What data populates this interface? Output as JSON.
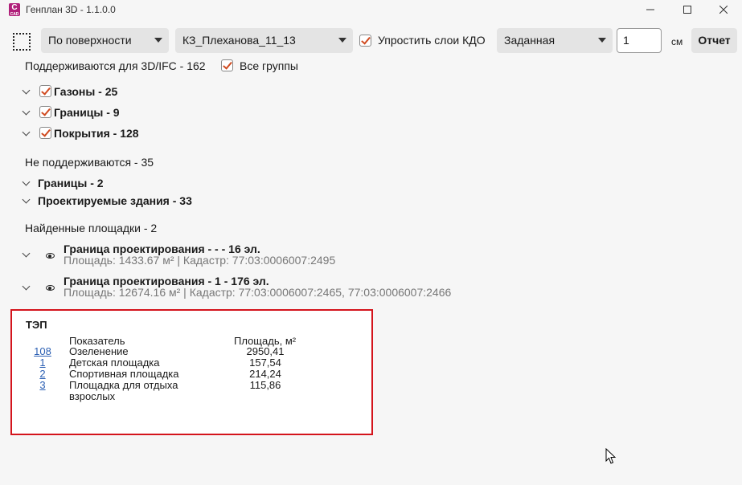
{
  "window": {
    "title": "Генплан 3D - 1.1.0.0",
    "icon_text": "C",
    "icon_sub": "CAD"
  },
  "toolbar": {
    "mode_dropdown": "По поверхности",
    "object_dropdown": "КЗ_Плеханова_11_13",
    "simplify_label": "Упростить слои КДО",
    "height_dropdown": "Заданная",
    "value_input": "1",
    "unit_label": "см",
    "report_button": "Отчет"
  },
  "supported": {
    "label": "Поддерживаются для 3D/IFC -  162",
    "all_groups_label": "Все группы",
    "groups": [
      {
        "label": "Газоны  -  25"
      },
      {
        "label": "Границы  -  9"
      },
      {
        "label": "Покрытия  -  128"
      }
    ]
  },
  "unsupported": {
    "label": "Не поддерживаются -  35",
    "groups": [
      {
        "label": "Границы  -  2"
      },
      {
        "label": "Проектируемые здания  -  33"
      }
    ]
  },
  "sites": {
    "label": "Найденные площадки -  2",
    "items": [
      {
        "title": "Граница проектирования  -  -  -  16  эл.",
        "details": "Площадь:  1433.67  м²   |  Кадастр:  77:03:0006007:2495"
      },
      {
        "title": "Граница проектирования  -  1  -  176  эл.",
        "details": "Площадь:  12674.16  м²   |  Кадастр:  77:03:0006007:2465, 77:03:0006007:2466"
      }
    ]
  },
  "tep": {
    "title": "ТЭП",
    "col_indicator": "Показатель",
    "col_area": "Площадь, м²",
    "rows": [
      {
        "count": "108",
        "name": "Озеленение",
        "area": "2950,41"
      },
      {
        "count": "1",
        "name": "Детская площадка",
        "area": "157,54"
      },
      {
        "count": "2",
        "name": "Спортивная площадка",
        "area": "214,24"
      },
      {
        "count": "3",
        "name": "Площадка для отдыха взрослых",
        "area": "115,86"
      }
    ]
  }
}
